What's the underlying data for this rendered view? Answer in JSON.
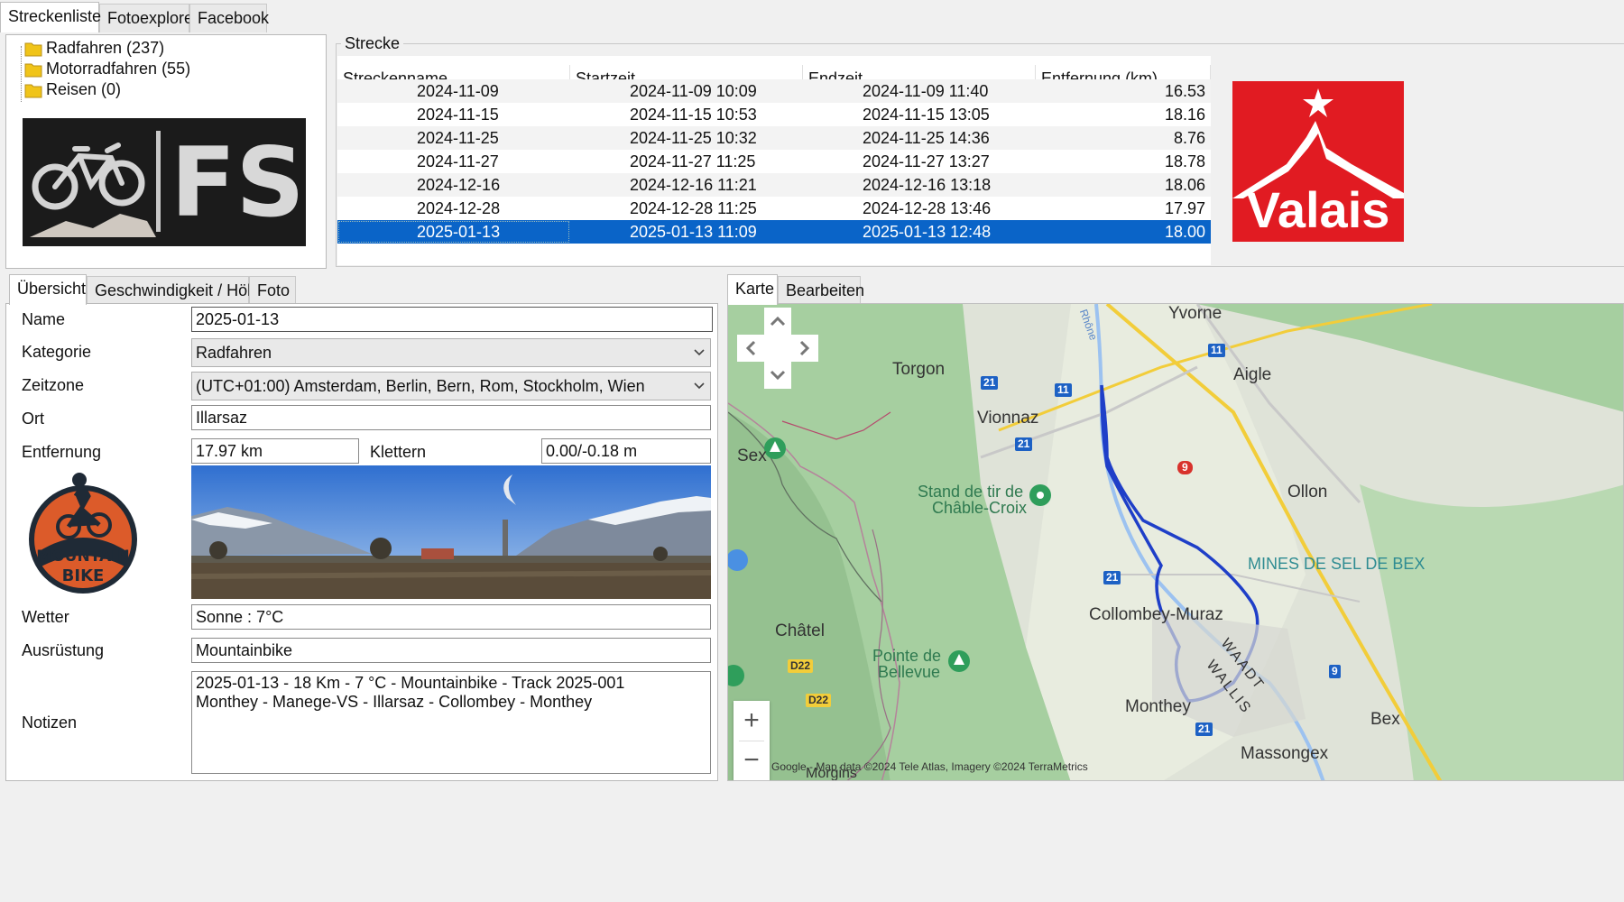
{
  "top_tabs": [
    "Streckenliste",
    "Fotoexplorer",
    "Facebook"
  ],
  "tree": [
    {
      "label": "Radfahren (237)"
    },
    {
      "label": "Motorradfahren (55)"
    },
    {
      "label": "Reisen (0)"
    }
  ],
  "logo_fs": {
    "text": "FS"
  },
  "strecke": {
    "group_title": "Strecke",
    "columns": [
      "Streckenname",
      "Startzeit",
      "Endzeit",
      "Entfernung (km)"
    ],
    "rows": [
      [
        "2024-11-09",
        "2024-11-09 10:09",
        "2024-11-09 11:40",
        "16.53"
      ],
      [
        "2024-11-15",
        "2024-11-15 10:53",
        "2024-11-15 13:05",
        "18.16"
      ],
      [
        "2024-11-25",
        "2024-11-25 10:32",
        "2024-11-25 14:36",
        "8.76"
      ],
      [
        "2024-11-27",
        "2024-11-27 11:25",
        "2024-11-27 13:27",
        "18.78"
      ],
      [
        "2024-12-16",
        "2024-12-16 11:21",
        "2024-12-16 13:18",
        "18.06"
      ],
      [
        "2024-12-28",
        "2024-12-28 11:25",
        "2024-12-28 13:46",
        "17.97"
      ],
      [
        "2025-01-13",
        "2025-01-13 11:09",
        "2025-01-13 12:48",
        "18.00"
      ]
    ],
    "selected_index": 6
  },
  "valais_logo": {
    "text": "Valais",
    "color": "#e11b22"
  },
  "detail_tabs": [
    "Übersicht",
    "Geschwindigkeit / Höhe",
    "Foto"
  ],
  "details": {
    "name_label": "Name",
    "name_value": "2025-01-13",
    "kategorie_label": "Kategorie",
    "kategorie_value": "Radfahren",
    "zeitzone_label": "Zeitzone",
    "zeitzone_value": "(UTC+01:00) Amsterdam, Berlin, Bern, Rom, Stockholm, Wien",
    "ort_label": "Ort",
    "ort_value": "Illarsaz",
    "entfernung_label": "Entfernung",
    "entfernung_value": "17.97 km",
    "klettern_label": "Klettern",
    "klettern_value": "0.00/-0.18 m",
    "wetter_label": "Wetter",
    "wetter_value": "Sonne  :  7°C",
    "ausruestung_label": "Ausrüstung",
    "ausruestung_value": "Mountainbike",
    "notizen_label": "Notizen",
    "notizen_line1": "2025-01-13  -  18 Km  -  7 °C  -  Mountainbike  -  Track 2025-001",
    "notizen_line2": "Monthey - Manege-VS - Illarsaz - Collombey - Monthey"
  },
  "mtb_logo": {
    "text1": "MOUNTAIN",
    "text2": "BIKE"
  },
  "map_tabs": [
    "Karte",
    "Bearbeiten"
  ],
  "map": {
    "places": [
      "Yvorne",
      "Aigle",
      "Torgon",
      "Vionnaz",
      "Stand de tir de",
      "Châble-Croix",
      "Ollon",
      "MINES DE SEL DE BEX",
      "Collombey-Muraz",
      "Châtel",
      "Pointe de",
      "Bellevue",
      "Monthey",
      "Bex",
      "Massongex",
      "Sex",
      "WAADT",
      "WALLIS",
      "Morgins",
      "Rhône"
    ],
    "road_badges": [
      "11",
      "21",
      "11",
      "21",
      "9",
      "21",
      "D22",
      "D22",
      "9",
      "21"
    ],
    "attribution": "Google - Map data ©2024 Tele Atlas, Imagery ©2024 TerraMetrics",
    "zoom_in": "+",
    "zoom_out": "−"
  }
}
